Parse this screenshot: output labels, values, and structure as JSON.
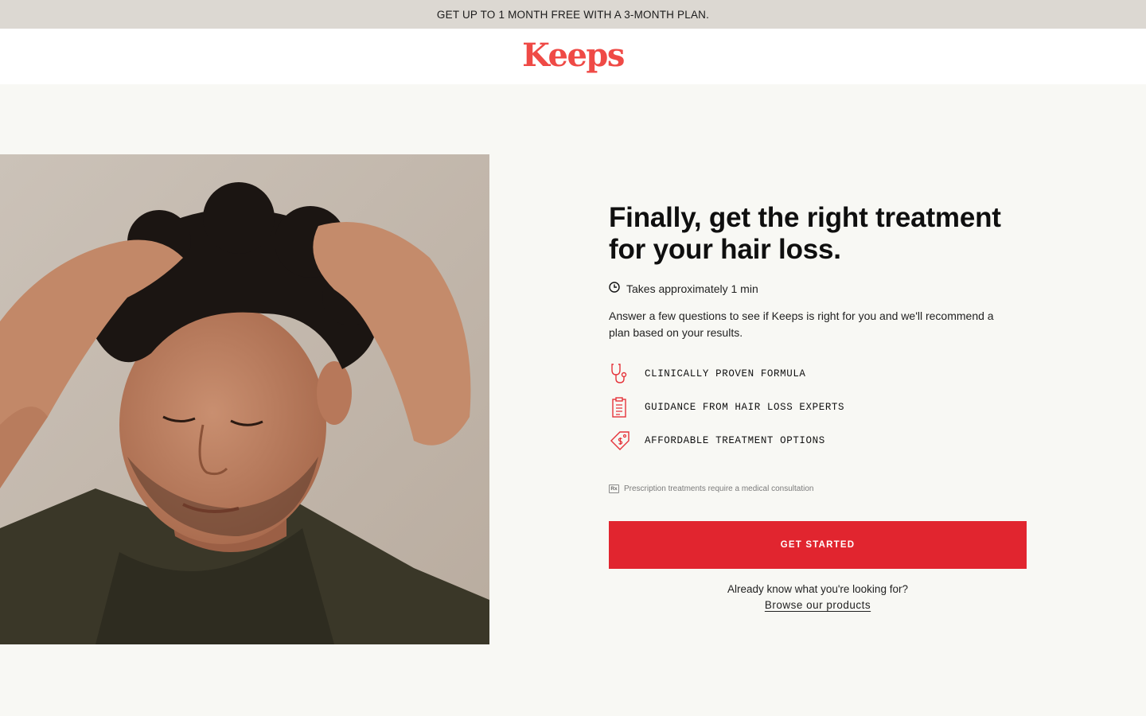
{
  "promo": {
    "text": "GET UP TO 1 MONTH FREE WITH A 3-MONTH PLAN."
  },
  "header": {
    "logo_text": "Keeps"
  },
  "hero": {
    "image_icon": "man-touching-hair-photo"
  },
  "main": {
    "headline": "Finally, get the right treatment for your hair loss.",
    "duration": {
      "icon": "clock-icon",
      "text": "Takes approximately 1 min"
    },
    "intro": "Answer a few questions to see if Keeps is right for you and we'll recommend a plan based on your results.",
    "features": [
      {
        "icon": "stethoscope-icon",
        "label": "CLINICALLY PROVEN FORMULA"
      },
      {
        "icon": "clipboard-icon",
        "label": "GUIDANCE FROM HAIR LOSS EXPERTS"
      },
      {
        "icon": "price-tag-icon",
        "label": "AFFORDABLE TREATMENT OPTIONS"
      }
    ],
    "rx_note": {
      "badge": "Rx",
      "text": "Prescription treatments require a medical consultation"
    },
    "cta_label": "GET STARTED",
    "already_text": "Already know what you're looking for?",
    "browse_link": "Browse our products"
  },
  "colors": {
    "accent": "#e1252f",
    "logo": "#ef4a46",
    "promo_bg": "#dcd8d2",
    "page_bg": "#f8f8f4",
    "icon_stroke": "#e5333a"
  }
}
